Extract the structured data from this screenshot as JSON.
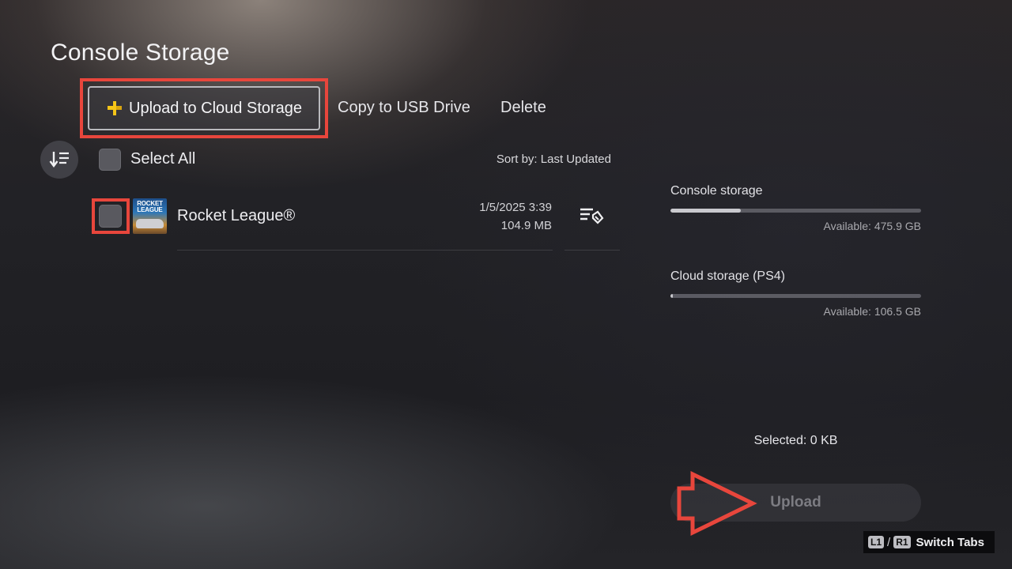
{
  "page": {
    "title": "Console Storage"
  },
  "tabs": {
    "upload_cloud": "Upload to Cloud Storage",
    "copy_usb": "Copy to USB Drive",
    "delete": "Delete"
  },
  "list_header": {
    "select_all": "Select All",
    "sort_by": "Sort by: Last Updated"
  },
  "games": [
    {
      "title": "Rocket League®",
      "thumb_logo": "ROCKET LEAGUE",
      "date": "1/5/2025  3:39",
      "size": "104.9 MB",
      "checked": false
    }
  ],
  "storage": {
    "console": {
      "label": "Console storage",
      "available": "Available: 475.9 GB",
      "used_fraction": 0.28
    },
    "cloud": {
      "label": "Cloud storage (PS4)",
      "available": "Available: 106.5 GB",
      "used_fraction": 0.01
    }
  },
  "selection": {
    "selected_text": "Selected: 0 KB"
  },
  "actions": {
    "upload_label": "Upload"
  },
  "hints": {
    "l1": "L1",
    "slash": "/",
    "r1": "R1",
    "switch_tabs": "Switch Tabs"
  },
  "colors": {
    "annotation": "#e8463c",
    "ps_plus": "#f5c518"
  }
}
